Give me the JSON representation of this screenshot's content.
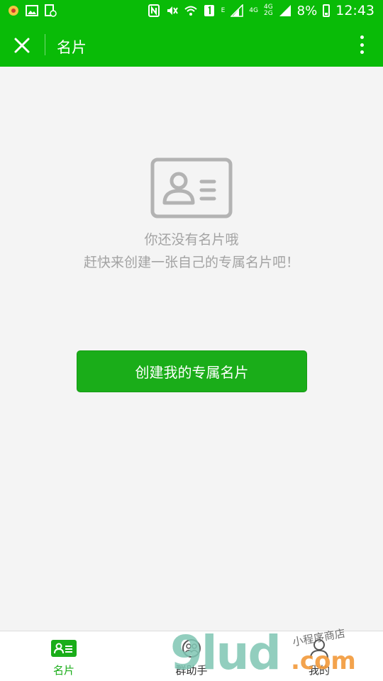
{
  "status_bar": {
    "battery": "8%",
    "time": "12:43",
    "net_e": "E",
    "net_4g_a": "4G",
    "net_4g_b": "4G",
    "net_2g": "2G"
  },
  "header": {
    "title": "名片"
  },
  "empty_state": {
    "line1": "你还没有名片哦",
    "line2": "赶快来创建一张自己的专属名片吧！"
  },
  "actions": {
    "create_label": "创建我的专属名片"
  },
  "tabs": [
    {
      "label": "名片",
      "icon": "card-icon",
      "active": true
    },
    {
      "label": "群助手",
      "icon": "group-icon",
      "active": false
    },
    {
      "label": "我的",
      "icon": "person-icon",
      "active": false
    }
  ],
  "watermark": {
    "big": "9lud",
    "com": ".com",
    "small": "小程序商店"
  },
  "colors": {
    "brand_green": "#09bb07",
    "button_green": "#1aad19",
    "hint_gray": "#a3a3a3",
    "background": "#f4f4f4"
  }
}
